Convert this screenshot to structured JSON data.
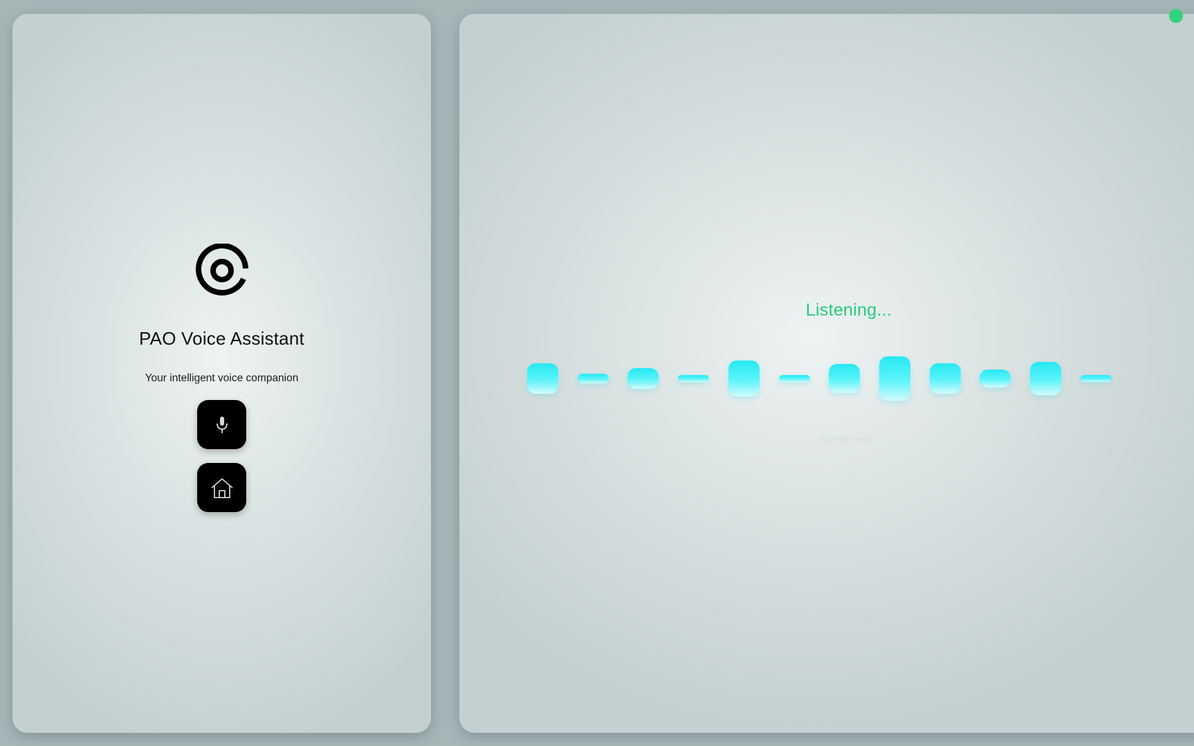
{
  "app": {
    "title": "PAO Voice Assistant",
    "subtitle": "Your intelligent voice companion"
  },
  "icons": {
    "logo": "at-sign-logo-icon",
    "mic": "microphone-icon",
    "home": "home-icon",
    "status": "status-dot-icon"
  },
  "buttons": {
    "mic_label": "",
    "home_label": ""
  },
  "voice": {
    "status_text": "Listening...",
    "hint_text": "Speak now...",
    "levels": [
      0.7,
      0.22,
      0.47,
      0.15,
      0.8,
      0.15,
      0.65,
      1.0,
      0.7,
      0.42,
      0.75,
      0.15
    ]
  },
  "colors": {
    "accent_green": "#25cc7a",
    "status_dot": "#2fd27d",
    "wave_cyan": "#26e8f2",
    "button_bg": "#000000"
  }
}
